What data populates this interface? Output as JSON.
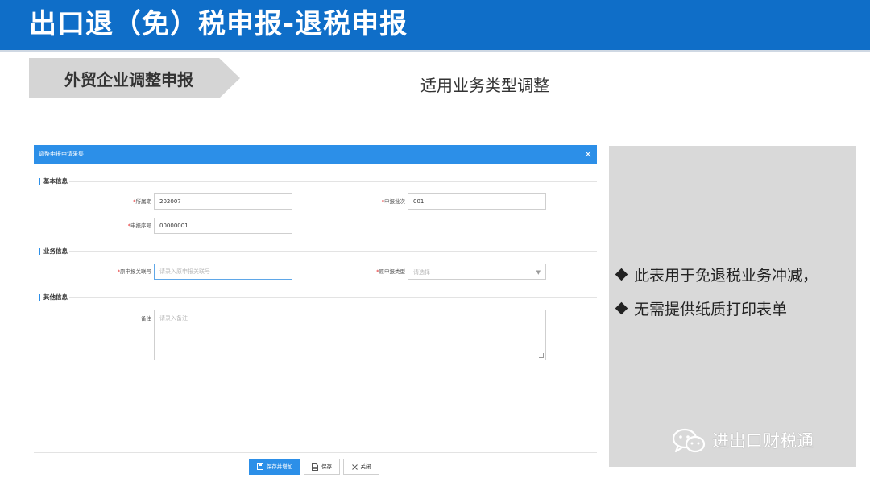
{
  "slide": {
    "title": "出口退（免）税申报-退税申报",
    "chevron_label": "外贸企业调整申报",
    "subtitle": "适用业务类型调整"
  },
  "dialog": {
    "title": "调整申报申请采集",
    "close": "×",
    "sections": {
      "basic": "基本信息",
      "business": "业务信息",
      "other": "其他信息"
    },
    "fields": {
      "period": {
        "label": "所属期",
        "value": "202007"
      },
      "batch": {
        "label": "申报批次",
        "value": "001"
      },
      "seq": {
        "label": "申报序号",
        "value": "00000001"
      },
      "orig_no": {
        "label": "原申报关联号",
        "placeholder": "请录入原申报关联号"
      },
      "orig_type": {
        "label": "原申报类型",
        "placeholder": "请选择"
      },
      "remark": {
        "label": "备注",
        "placeholder": "请录入备注"
      }
    },
    "buttons": {
      "save_add": "保存并增加",
      "save": "保存",
      "close": "关闭"
    }
  },
  "notes": [
    "此表用于免退税业务冲减，",
    "无需提供纸质打印表单"
  ],
  "watermark": "进出口财税通",
  "colors": {
    "banner": "#0f6ec8",
    "dialog_header": "#2c8fe8",
    "panel": "#d9d9d9"
  }
}
